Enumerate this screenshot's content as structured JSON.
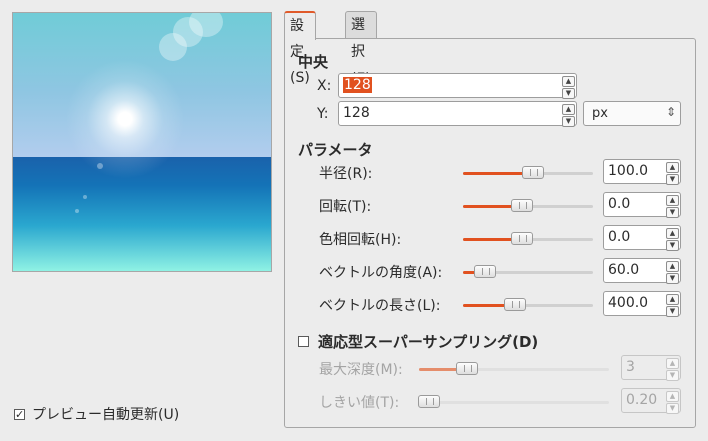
{
  "preview_checkbox": {
    "checked": true,
    "label": "プレビュー自動更新(U)"
  },
  "tabs": [
    {
      "label": "設定(S)",
      "active": true
    },
    {
      "label": "選択(E)",
      "active": false
    }
  ],
  "center": {
    "heading": "中央",
    "x_label": "X:",
    "x_value": "128",
    "y_label": "Y:",
    "y_value": "128",
    "unit": "px"
  },
  "parameters": {
    "heading": "パラメータ",
    "rows": [
      {
        "label": "半径(R):",
        "value": "100.0",
        "fraction": 0.54
      },
      {
        "label": "回転(T):",
        "value": "0.0",
        "fraction": 0.45
      },
      {
        "label": "色相回転(H):",
        "value": "0.0",
        "fraction": 0.45
      },
      {
        "label": "ベクトルの角度(A):",
        "value": "60.0",
        "fraction": 0.17
      },
      {
        "label": "ベクトルの長さ(L):",
        "value": "400.0",
        "fraction": 0.4
      }
    ]
  },
  "supersampling": {
    "checked": false,
    "label": "適応型スーパーサンプリング(D)",
    "rows": [
      {
        "label": "最大深度(M):",
        "value": "3",
        "fraction": 0.25
      },
      {
        "label": "しきい値(T):",
        "value": "0.20",
        "fraction": 0.05
      }
    ]
  },
  "icons": {
    "check": "✓",
    "spin_up": "▲",
    "spin_down": "▼",
    "combo_arrows": "⇕"
  }
}
